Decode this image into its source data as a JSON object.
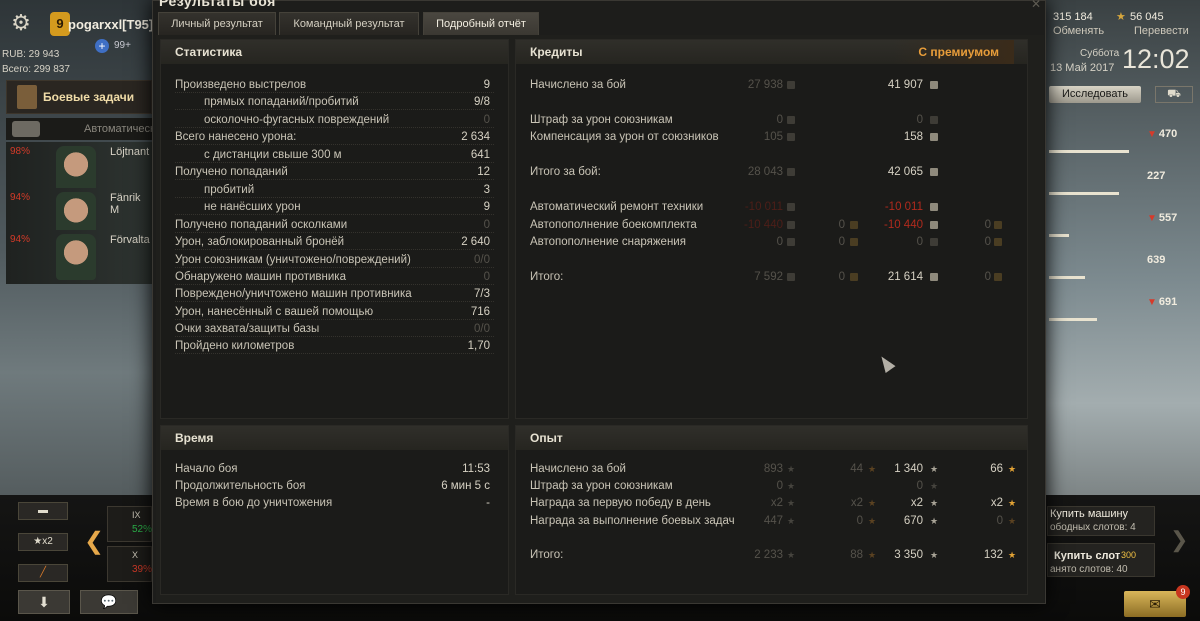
{
  "window": {
    "title": "Результаты боя",
    "tabs": [
      "Личный результат",
      "Командный результат",
      "Подробный отчёт"
    ]
  },
  "player": {
    "badge": "9",
    "name": "pogarxxl[T95]",
    "premium_count": "99+",
    "rub": "RUB: 29 943",
    "total": "Всего: 299 837",
    "missions_label": "Боевые задачи",
    "crew_label": "Автоматическ"
  },
  "crew": [
    {
      "name": "Löjtnant",
      "pct": "98%"
    },
    {
      "name": "Fänrik M",
      "pct": "94%"
    },
    {
      "name": "Förvalta",
      "pct": "94%"
    }
  ],
  "header_right": {
    "gold": "315 184",
    "gold_action": "Обменять",
    "free_xp": "56 045",
    "free_xp_action": "Перевести",
    "weekday": "Суббота",
    "date": "13 Май 2017",
    "time": "12:02",
    "research_button": "Исследовать"
  },
  "vehicle_stats": [
    {
      "value": "470",
      "down": true
    },
    {
      "value": "227",
      "down": false
    },
    {
      "value": "557",
      "down": true
    },
    {
      "value": "639",
      "down": false
    },
    {
      "value": "691",
      "down": true
    }
  ],
  "carousel": [
    {
      "tier": "IX",
      "pct": "52%",
      "color": "#2bb34a"
    },
    {
      "tier": "X",
      "pct": "39%",
      "color": "#d23a28"
    }
  ],
  "bottom_left": {
    "x2_label": "x2"
  },
  "bottom_right": {
    "buy_tank": "Купить машину",
    "free_slots": "ободных слотов: 4",
    "buy_slot": "Купить слот",
    "slot_cost": "300",
    "occupied": "анято слотов: 40",
    "notif_count": "9"
  },
  "statistics": {
    "title": "Статистика",
    "rows": [
      {
        "label": "Произведено выстрелов",
        "value": "9",
        "indent": false,
        "dim": false
      },
      {
        "label": "прямых попаданий/пробитий",
        "value": "9/8",
        "indent": true,
        "dim": false
      },
      {
        "label": "осколочно-фугасных повреждений",
        "value": "0",
        "indent": true,
        "dim": true
      },
      {
        "label": "Всего нанесено урона:",
        "value": "2 634",
        "indent": false,
        "dim": false
      },
      {
        "label": "с дистанции свыше 300 м",
        "value": "641",
        "indent": true,
        "dim": false
      },
      {
        "label": "Получено попаданий",
        "value": "12",
        "indent": false,
        "dim": false
      },
      {
        "label": "пробитий",
        "value": "3",
        "indent": true,
        "dim": false
      },
      {
        "label": "не нанёсших урон",
        "value": "9",
        "indent": true,
        "dim": false
      },
      {
        "label": "Получено попаданий осколками",
        "value": "0",
        "indent": false,
        "dim": true
      },
      {
        "label": "Урон, заблокированный бронёй",
        "value": "2 640",
        "indent": false,
        "dim": false
      },
      {
        "label": "Урон союзникам (уничтожено/повреждений)",
        "value": "0/0",
        "indent": false,
        "dim": true
      },
      {
        "label": "Обнаружено машин противника",
        "value": "0",
        "indent": false,
        "dim": true
      },
      {
        "label": "Повреждено/уничтожено машин противника",
        "value": "7/3",
        "indent": false,
        "dim": false
      },
      {
        "label": "Урон, нанесённый с вашей помощью",
        "value": "716",
        "indent": false,
        "dim": false
      },
      {
        "label": "Очки захвата/защиты базы",
        "value": "0/0",
        "indent": false,
        "dim": true
      },
      {
        "label": "Пройдено километров",
        "value": "1,70",
        "indent": false,
        "dim": false
      }
    ]
  },
  "credits": {
    "title": "Кредиты",
    "premium_label": "С премиумом",
    "rows": [
      {
        "label": "Начислено за бой",
        "std": "27 938",
        "std_gold": "",
        "prem": "41 907",
        "prem_gold": "",
        "style": "earn"
      },
      {
        "label": "Штраф за урон союзникам",
        "std": "0",
        "std_gold": "",
        "prem": "0",
        "prem_gold": "",
        "style": "zero"
      },
      {
        "label": "Компенсация за урон от союзников",
        "std": "105",
        "std_gold": "",
        "prem": "158",
        "prem_gold": "",
        "style": "earn"
      },
      {
        "label": "Итого за бой:",
        "std": "28 043",
        "std_gold": "",
        "prem": "42 065",
        "prem_gold": "",
        "style": "earn"
      },
      {
        "label": "Автоматический ремонт техники",
        "std": "-10 011",
        "std_gold": "",
        "prem": "-10 011",
        "prem_gold": "",
        "style": "neg"
      },
      {
        "label": "Автопополнение боекомплекта",
        "std": "-10 440",
        "std_gold": "0",
        "prem": "-10 440",
        "prem_gold": "0",
        "style": "neg"
      },
      {
        "label": "Автопополнение снаряжения",
        "std": "0",
        "std_gold": "0",
        "prem": "0",
        "prem_gold": "0",
        "style": "zero"
      },
      {
        "label": "Итого:",
        "std": "7 592",
        "std_gold": "0",
        "prem": "21 614",
        "prem_gold": "0",
        "style": "earn"
      }
    ]
  },
  "time": {
    "title": "Время",
    "rows": [
      {
        "label": "Начало боя",
        "value": "11:53"
      },
      {
        "label": "Продолжительность боя",
        "value": "6 мин 5 с"
      },
      {
        "label": "Время в бою до уничтожения",
        "value": "-"
      }
    ]
  },
  "experience": {
    "title": "Опыт",
    "rows": [
      {
        "label": "Начислено за бой",
        "std": "893",
        "std_free": "44",
        "prem": "1 340",
        "prem_free": "66"
      },
      {
        "label": "Штраф за урон союзникам",
        "std": "0",
        "std_free": "",
        "prem": "0",
        "prem_free": ""
      },
      {
        "label": "Награда за первую победу в день",
        "std": "x2",
        "std_free": "x2",
        "prem": "x2",
        "prem_free": "x2"
      },
      {
        "label": "Награда за выполнение боевых задач",
        "std": "447",
        "std_free": "0",
        "prem": "670",
        "prem_free": "0"
      },
      {
        "label": "Итого:",
        "std": "2 233",
        "std_free": "88",
        "prem": "3 350",
        "prem_free": "132"
      }
    ]
  }
}
